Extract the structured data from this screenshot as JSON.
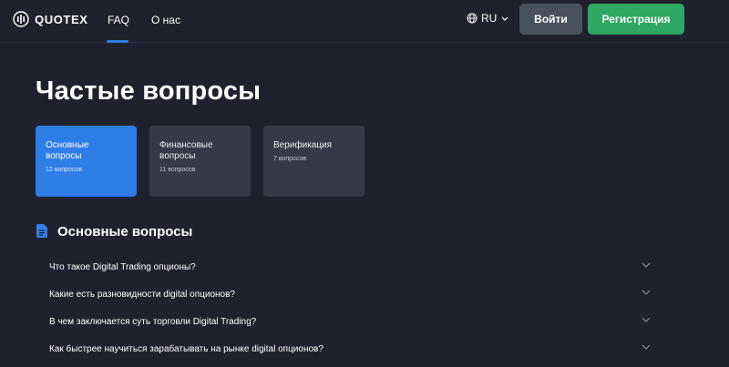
{
  "header": {
    "logo_text": "QUOTEX",
    "nav": [
      {
        "label": "FAQ",
        "active": true
      },
      {
        "label": "О нас",
        "active": false
      }
    ],
    "language": "RU",
    "login_label": "Войти",
    "register_label": "Регистрация"
  },
  "page_title": "Частые вопросы",
  "categories": [
    {
      "title": "Основные вопросы",
      "count": "12 вопросов",
      "active": true
    },
    {
      "title": "Финансовые вопросы",
      "count": "11 вопросов",
      "active": false
    },
    {
      "title": "Верификация",
      "count": "7 вопросов",
      "active": false
    }
  ],
  "section": {
    "title": "Основные вопросы",
    "icon": "document-icon"
  },
  "faq": [
    {
      "question": "Что такое Digital Trading опционы?"
    },
    {
      "question": "Какие есть разновидности digital опционов?"
    },
    {
      "question": "В чем заключается суть торговли Digital Trading?"
    },
    {
      "question": "Как быстрее научиться зарабатывать на рынке digital опционов?"
    }
  ],
  "colors": {
    "background": "#1f222e",
    "accent": "#2f7de6",
    "register": "#2ea862",
    "login": "#4a505e",
    "card": "#363a48"
  }
}
